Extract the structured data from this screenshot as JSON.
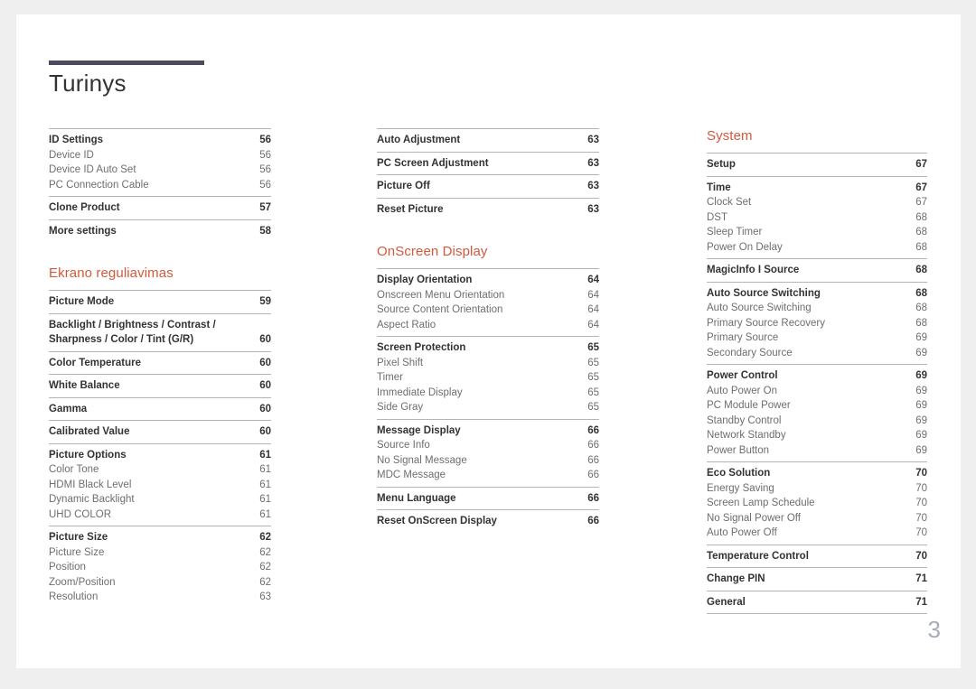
{
  "document": {
    "title": "Turinys",
    "page_number": "3",
    "accent_color": "#d6573b",
    "rule_color": "#4b4b5c",
    "background_color": "#efefef",
    "page_color": "#ffffff"
  },
  "columns": [
    {
      "id": "column-1",
      "blocks": [
        {
          "type": "toc-group",
          "rows": [
            {
              "label": "ID Settings",
              "page": "56",
              "level": "main"
            },
            {
              "label": "Device ID",
              "page": "56",
              "level": "sub"
            },
            {
              "label": "Device ID Auto Set",
              "page": "56",
              "level": "sub"
            },
            {
              "label": "PC Connection Cable",
              "page": "56",
              "level": "sub"
            }
          ]
        },
        {
          "type": "toc-group",
          "rows": [
            {
              "label": "Clone Product",
              "page": "57",
              "level": "main"
            }
          ]
        },
        {
          "type": "toc-group",
          "rows": [
            {
              "label": "More settings",
              "page": "58",
              "level": "main"
            }
          ]
        },
        {
          "type": "spacer",
          "size": "26"
        },
        {
          "type": "heading",
          "label": "Ekrano reguliavimas"
        },
        {
          "type": "toc-group",
          "rows": [
            {
              "label": "Picture Mode",
              "page": "59",
              "level": "main"
            }
          ]
        },
        {
          "type": "toc-group",
          "rows": [
            {
              "label": "Backlight / Brightness / Contrast /\nSharpness / Color / Tint (G/R)",
              "page": "60",
              "level": "main"
            }
          ]
        },
        {
          "type": "toc-group",
          "rows": [
            {
              "label": "Color Temperature",
              "page": "60",
              "level": "main"
            }
          ]
        },
        {
          "type": "toc-group",
          "rows": [
            {
              "label": "White Balance",
              "page": "60",
              "level": "main"
            }
          ]
        },
        {
          "type": "toc-group",
          "rows": [
            {
              "label": "Gamma",
              "page": "60",
              "level": "main"
            }
          ]
        },
        {
          "type": "toc-group",
          "rows": [
            {
              "label": "Calibrated Value",
              "page": "60",
              "level": "main"
            }
          ]
        },
        {
          "type": "toc-group",
          "rows": [
            {
              "label": "Picture Options",
              "page": "61",
              "level": "main"
            },
            {
              "label": "Color Tone",
              "page": "61",
              "level": "sub"
            },
            {
              "label": "HDMI Black Level",
              "page": "61",
              "level": "sub"
            },
            {
              "label": "Dynamic Backlight",
              "page": "61",
              "level": "sub"
            },
            {
              "label": "UHD COLOR",
              "page": "61",
              "level": "sub"
            }
          ]
        },
        {
          "type": "toc-group",
          "rows": [
            {
              "label": "Picture Size",
              "page": "62",
              "level": "main"
            },
            {
              "label": "Picture Size",
              "page": "62",
              "level": "sub"
            },
            {
              "label": "Position",
              "page": "62",
              "level": "sub"
            },
            {
              "label": "Zoom/Position",
              "page": "62",
              "level": "sub"
            },
            {
              "label": "Resolution",
              "page": "63",
              "level": "sub"
            }
          ]
        }
      ]
    },
    {
      "id": "column-2",
      "blocks": [
        {
          "type": "toc-group",
          "rows": [
            {
              "label": "Auto Adjustment",
              "page": "63",
              "level": "main"
            }
          ]
        },
        {
          "type": "toc-group",
          "rows": [
            {
              "label": "PC Screen Adjustment",
              "page": "63",
              "level": "main"
            }
          ]
        },
        {
          "type": "toc-group",
          "rows": [
            {
              "label": "Picture Off",
              "page": "63",
              "level": "main"
            }
          ]
        },
        {
          "type": "toc-group",
          "rows": [
            {
              "label": "Reset Picture",
              "page": "63",
              "level": "main"
            }
          ]
        },
        {
          "type": "spacer",
          "size": "26"
        },
        {
          "type": "heading",
          "label": "OnScreen Display"
        },
        {
          "type": "toc-group",
          "rows": [
            {
              "label": "Display Orientation",
              "page": "64",
              "level": "main"
            },
            {
              "label": "Onscreen Menu Orientation",
              "page": "64",
              "level": "sub"
            },
            {
              "label": "Source Content Orientation",
              "page": "64",
              "level": "sub"
            },
            {
              "label": "Aspect Ratio",
              "page": "64",
              "level": "sub"
            }
          ]
        },
        {
          "type": "toc-group",
          "rows": [
            {
              "label": "Screen Protection",
              "page": "65",
              "level": "main"
            },
            {
              "label": "Pixel Shift",
              "page": "65",
              "level": "sub"
            },
            {
              "label": "Timer",
              "page": "65",
              "level": "sub"
            },
            {
              "label": "Immediate Display",
              "page": "65",
              "level": "sub"
            },
            {
              "label": "Side Gray",
              "page": "65",
              "level": "sub"
            }
          ]
        },
        {
          "type": "toc-group",
          "rows": [
            {
              "label": "Message Display",
              "page": "66",
              "level": "main"
            },
            {
              "label": "Source Info",
              "page": "66",
              "level": "sub"
            },
            {
              "label": "No Signal Message",
              "page": "66",
              "level": "sub"
            },
            {
              "label": "MDC Message",
              "page": "66",
              "level": "sub"
            }
          ]
        },
        {
          "type": "toc-group",
          "rows": [
            {
              "label": "Menu Language",
              "page": "66",
              "level": "main"
            }
          ]
        },
        {
          "type": "toc-group",
          "rows": [
            {
              "label": "Reset OnScreen Display",
              "page": "66",
              "level": "main"
            }
          ]
        }
      ]
    },
    {
      "id": "column-3",
      "blocks": [
        {
          "type": "heading",
          "label": "System"
        },
        {
          "type": "toc-group",
          "rows": [
            {
              "label": "Setup",
              "page": "67",
              "level": "main"
            }
          ]
        },
        {
          "type": "toc-group",
          "rows": [
            {
              "label": "Time",
              "page": "67",
              "level": "main"
            },
            {
              "label": "Clock Set",
              "page": "67",
              "level": "sub"
            },
            {
              "label": "DST",
              "page": "68",
              "level": "sub"
            },
            {
              "label": "Sleep Timer",
              "page": "68",
              "level": "sub"
            },
            {
              "label": "Power On Delay",
              "page": "68",
              "level": "sub"
            }
          ]
        },
        {
          "type": "toc-group",
          "rows": [
            {
              "label": "MagicInfo I Source",
              "page": "68",
              "level": "main"
            }
          ]
        },
        {
          "type": "toc-group",
          "rows": [
            {
              "label": "Auto Source Switching",
              "page": "68",
              "level": "main"
            },
            {
              "label": "Auto Source Switching",
              "page": "68",
              "level": "sub"
            },
            {
              "label": "Primary Source Recovery",
              "page": "68",
              "level": "sub"
            },
            {
              "label": "Primary Source",
              "page": "69",
              "level": "sub"
            },
            {
              "label": "Secondary Source",
              "page": "69",
              "level": "sub"
            }
          ]
        },
        {
          "type": "toc-group",
          "rows": [
            {
              "label": "Power Control",
              "page": "69",
              "level": "main"
            },
            {
              "label": "Auto Power On",
              "page": "69",
              "level": "sub"
            },
            {
              "label": "PC Module Power",
              "page": "69",
              "level": "sub"
            },
            {
              "label": "Standby Control",
              "page": "69",
              "level": "sub"
            },
            {
              "label": "Network Standby",
              "page": "69",
              "level": "sub"
            },
            {
              "label": "Power Button",
              "page": "69",
              "level": "sub"
            }
          ]
        },
        {
          "type": "toc-group",
          "rows": [
            {
              "label": "Eco Solution",
              "page": "70",
              "level": "main"
            },
            {
              "label": "Energy Saving",
              "page": "70",
              "level": "sub"
            },
            {
              "label": "Screen Lamp Schedule",
              "page": "70",
              "level": "sub"
            },
            {
              "label": "No Signal Power Off",
              "page": "70",
              "level": "sub"
            },
            {
              "label": "Auto Power Off",
              "page": "70",
              "level": "sub"
            }
          ]
        },
        {
          "type": "toc-group",
          "rows": [
            {
              "label": "Temperature Control",
              "page": "70",
              "level": "main"
            }
          ]
        },
        {
          "type": "toc-group",
          "rows": [
            {
              "label": "Change PIN",
              "page": "71",
              "level": "main"
            }
          ]
        },
        {
          "type": "toc-group",
          "last": true,
          "rows": [
            {
              "label": "General",
              "page": "71",
              "level": "main"
            }
          ]
        }
      ]
    }
  ]
}
